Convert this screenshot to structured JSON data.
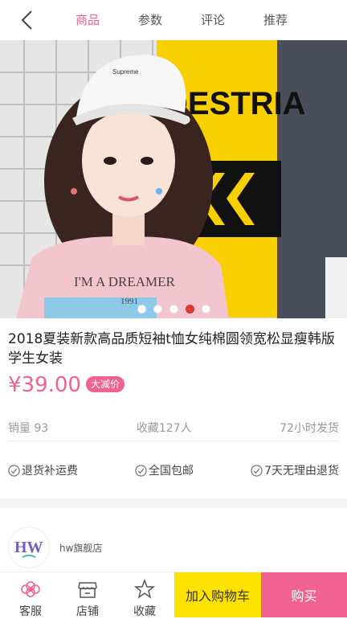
{
  "nav": {
    "tabs": [
      "商品",
      "参数",
      "评论",
      "推荐"
    ],
    "active_tab": 0
  },
  "hero": {
    "alt": "product photo",
    "slide_count": 5,
    "active_slide": 3,
    "sign_text": "DESTRIA",
    "shirt_text": "I'M A DREAMER",
    "shirt_year": "1991",
    "cap_text": "Supreme"
  },
  "product": {
    "title": "2018夏装新款高品质短袖t恤女纯棉圆领宽松显瘦韩版学生女装",
    "price": "¥39.00",
    "tag": "大减价",
    "stats": [
      "销量 93",
      "收藏127人",
      "72小时发货"
    ],
    "guarantees": [
      "退货补运费",
      "全国包邮",
      "7天无理由退货"
    ]
  },
  "store": {
    "name": "hw旗舰店",
    "logo_text": "HW"
  },
  "bottom": {
    "service": "客服",
    "shop": "店铺",
    "fav": "收藏",
    "cart": "加入购物车",
    "buy": "购买"
  },
  "colors": {
    "accent": "#f06292",
    "cart_bg": "#fde200"
  }
}
